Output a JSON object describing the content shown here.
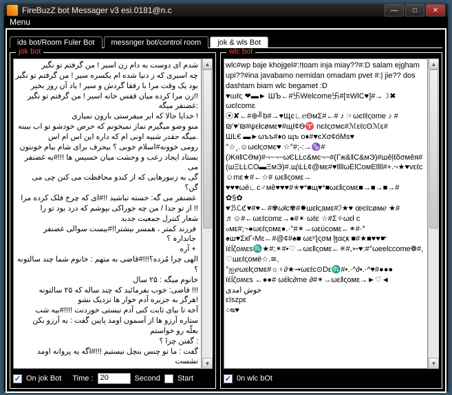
{
  "window": {
    "title": "FireBuzZ bot  Messager v3 esi.0181@n.c"
  },
  "menu": {
    "label": "Menu"
  },
  "tabs": [
    {
      "label": "ids bot/Room Fuler Bot",
      "active": false
    },
    {
      "label": "messnger bot/control room",
      "active": false
    },
    {
      "label": "jok & wls Bot",
      "active": true
    }
  ],
  "left": {
    "group_title": "jok bot",
    "text": "شدم ای دوست به دام زن اسیر ! من گرفتم تو نگیر\nچه اسیری که ز دنیا شده ام یکسره سیر ! من گرفتم تو نگیر\nبود یک وقت مرا با رفقا گردش و سیر ! یاد آن روز بخیر\n!!زن مرا کرده میان قفس خانه اسیر ! من گرفتم تو نگیر\n:غضنفر میگه\n! خدایا حالا که ابر میفرستی بارون نمیاری\nمنو وضو میگیرم نماز نمیخونم که حرص خودشو تو اب ببینه .میگه حقدر شبیه اونی ام که داره این اس ام اس\nرومی خوونه#اسلام خوبی ؟ بیحرف برای شام بیام خونتون\nبستاد ایجاد رعب و وحشت میان خسیس ها !!!#به غضنفر می\nگی به زنبورهایی که از کندو محافظت می کنن چی می\nگن؟\n غضنفر می گه: خسته نباشید !!#ای که چرخ فلک کرده مرا\n!! از تو جدا / من چه جوراکی بپوشم که درد بود تو را\nشعار کنترل جمعیت جدید\n فرزند کمتر ، همسر بیشتر!!#بیست سوالی غضنفر\n جاندارہ ؟\n + آره\nالهی چرا مُرده؟!!!#قاضی به متهم : خانوم شما چند سالتونه\n؟\nخانوم میگه : ۲۵ سال\n!!! قاضی: خوب بفرمائید که چند ساله که ۲۵ سالتونه\n!هرگز به جزیره آدم خوار ها نزدیک نشو\nآخه تا بیای ثابت کنی آدم نیستی خوردنت !!!!#بیه شب\nستاره آرزو ها از آسمون اومد پایین گفت : یه آرزو بکن\nبعلّه رو خواستم\n: گفتن چرا ؟\nگفت : ما تو چنس بنچل نیستیم !!!#اگه یه پروانه اومد نشست",
    "checkbox_label": "On jok Bot",
    "time_label": "Time :",
    "time_value": "20",
    "second_label": "Second",
    "start_label": "Start"
  },
  "right": {
    "group_title": "wlc bot",
    "text": "wlc#wp baje khojgel#:!toam inja miay??#:D salam ejgham upi??#ina javabamo nemidan omadam pvet #:| jie?? dos dashtam biam wlc begamet :D\n♥ɯℓς ❤▬► ШЪ←#卐Welcome卐#[≡WlC♥]#→☽✖\nωɛℓcomɛ\n⦿✘←#⊛╝b#→♥Щє∟℮ΘмΣ#←# ♪ ☞ωєℓℓςome ♪ #\n₪'♥'₪#ψεłcøмε♥#щℓ¢Ѳ♈ nєℓςσмє#ℳεℓсʘℳε#\nШĿ€ ▬►ωъъ#♦о щъ о♦#♥єXσ¢óMѕ♥\n°☆¸.☺ωєłςσмє♥ ☆°#;-:→♑#(ЖяǁCƏм)#¬~¬~ωЄĿĿс&мє¬~#(Гж&ǁС&мЭ)#шěļℓõσмêя#(шΞĿĿCO▬ΞмЭ)#.щ\\ĿĿ¢@мε#♥llllωElCoмEllll#+.¬★♥vεℓc☺mε★#←☆# ωεǁςoмε→\n♥♥♥ωē∟c♂мě♥♥♥#✭♥*■щ♥*■ωεǁςoмε■→■→■→#\n✿§✿\n♥ℬℒℭ♥#♥←#✾ωłc✾#✹шεłςaмε#ℐ★♥ œєℓсøмℯ ★#\n♬☺#←ωεℓcomε→●#✴ ωℓє ☆#Σ✧ωεł c ℴмε#;¬●ωεℓςoмε●.·°#✶→ωεύсомε←✶#·°\n♠ш♥ΣкГ‹Mε←#@¢#♠■ ωεˢƪςσм ɮαςҝ ■#★■♥♥☛ ïέĺζoʍεs♏★#;✴#•♡→ωεǁςoмε←✳#,➳♥:#°ωeelccome❁#,♡шεℓςoмё☆.≅,\n°ஐℯωεłςσмε#☼♀∂★⇝ωεℓc⊙Dε♏#•.·^∂•.·^♥#●●●\nïέĺζoʍεs ←●●# ωέłc∂me ∂#✴→ωεǁςoмε→►♡◄\nخوش امدی\nεïszρε\n○ᴓ♥",
    "checkbox_label": "0n wlc bOt"
  }
}
